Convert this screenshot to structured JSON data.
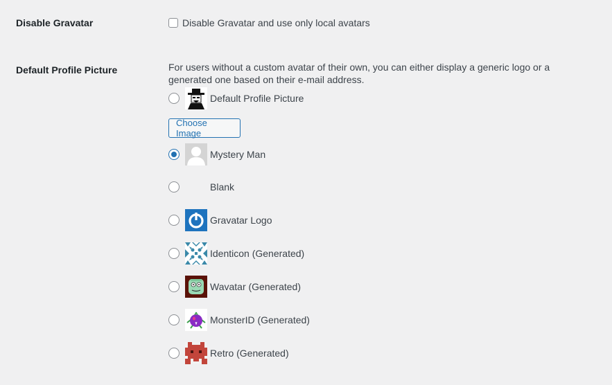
{
  "disable_gravatar": {
    "label": "Disable Gravatar",
    "checkbox_label": "Disable Gravatar and use only local avatars",
    "checked": false
  },
  "default_picture": {
    "label": "Default Profile Picture",
    "description": "For users without a custom avatar of their own, you can either display a generic logo or a generated one based on their e-mail address.",
    "choose_button": "Choose Image",
    "options": [
      {
        "label": "Default Profile Picture",
        "icon": "custom-avatar-icon",
        "checked": false
      },
      {
        "label": "Mystery Man",
        "icon": "mystery-man-icon",
        "checked": true
      },
      {
        "label": "Blank",
        "icon": "",
        "checked": false
      },
      {
        "label": "Gravatar Logo",
        "icon": "gravatar-logo-icon",
        "checked": false
      },
      {
        "label": "Identicon (Generated)",
        "icon": "identicon-icon",
        "checked": false
      },
      {
        "label": "Wavatar (Generated)",
        "icon": "wavatar-icon",
        "checked": false
      },
      {
        "label": "MonsterID (Generated)",
        "icon": "monsterid-icon",
        "checked": false
      },
      {
        "label": "Retro (Generated)",
        "icon": "retro-icon",
        "checked": false
      }
    ]
  },
  "colors": {
    "background": "#f0f0f1",
    "accent": "#2271b1",
    "text": "#1d2327"
  }
}
